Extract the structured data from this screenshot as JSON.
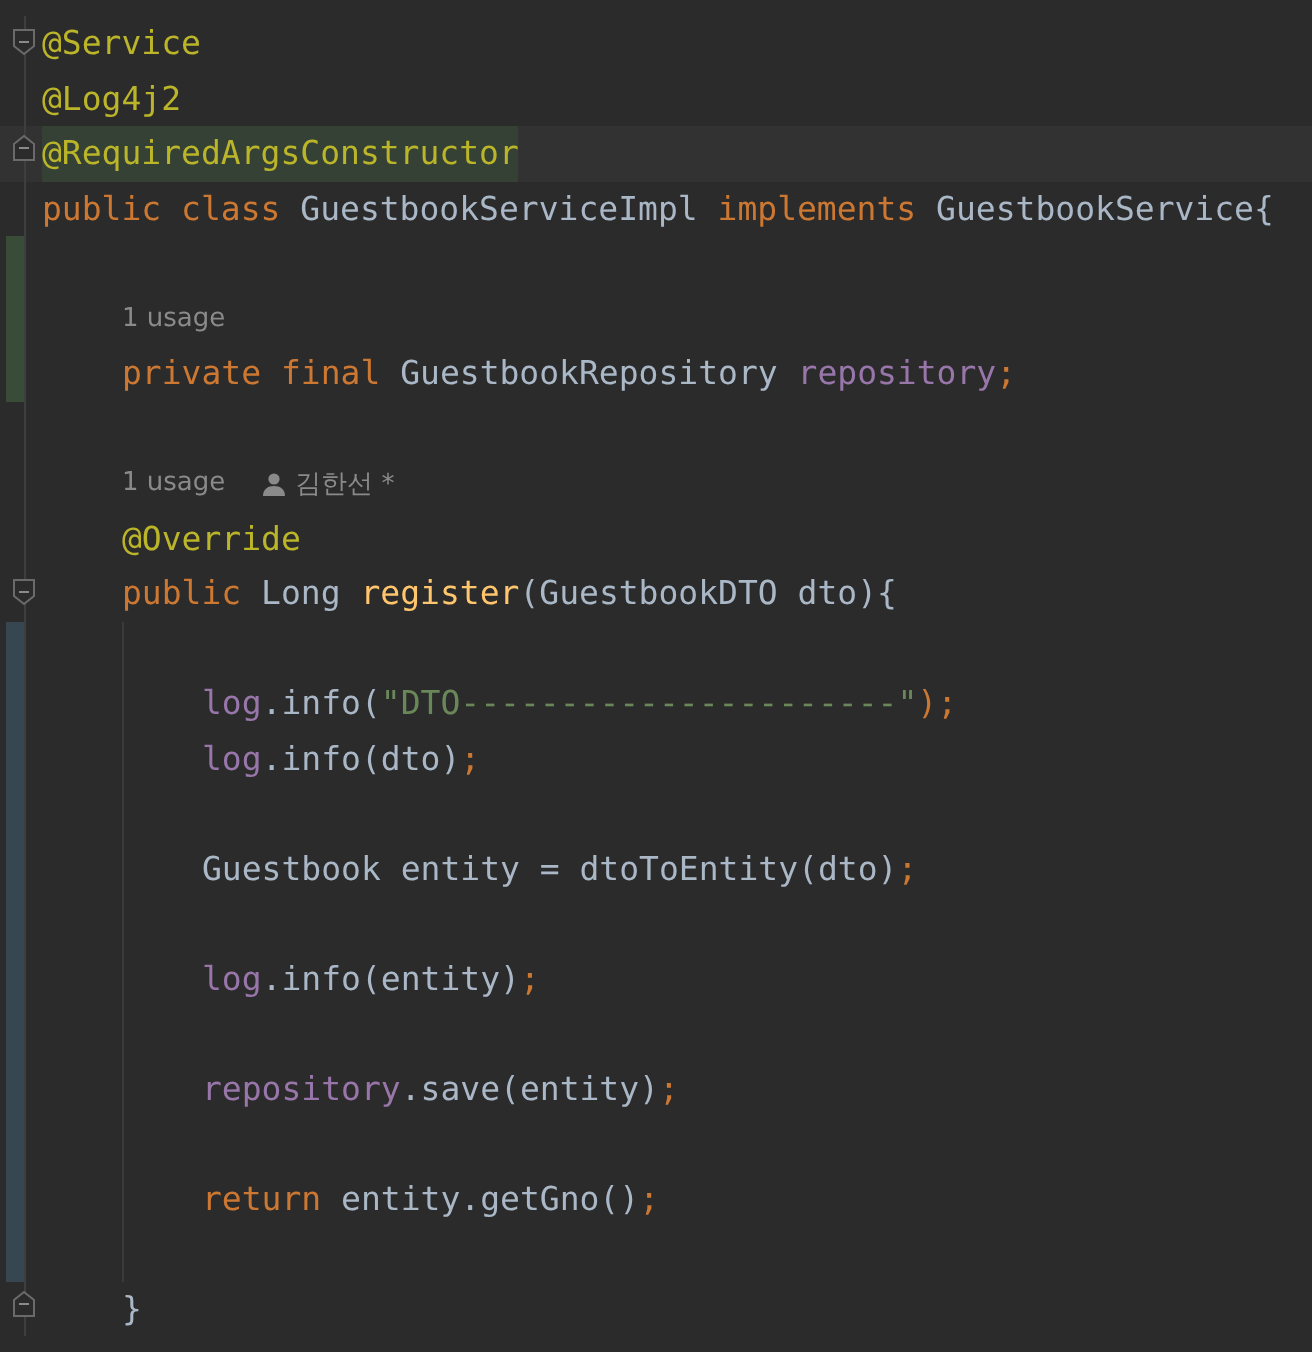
{
  "lines": [
    {
      "kind": "code",
      "gutter": {
        "kind": "fold-start"
      },
      "tokens": [
        {
          "text": "@Service",
          "kind": "annotation"
        }
      ]
    },
    {
      "kind": "code",
      "tokens": [
        {
          "text": "@Log4j2",
          "kind": "annotation"
        }
      ]
    },
    {
      "kind": "code",
      "gutter": {
        "kind": "fold-end"
      },
      "highlighted": true,
      "tokens": [
        {
          "text": "@RequiredArgsConstructor",
          "kind": "annotation"
        }
      ]
    },
    {
      "kind": "code",
      "tokens": [
        {
          "text": "public class ",
          "kind": "keyword"
        },
        {
          "text": "GuestbookServiceImpl ",
          "kind": "type"
        },
        {
          "text": "implements ",
          "kind": "keyword"
        },
        {
          "text": "GuestbookService{",
          "kind": "type"
        }
      ],
      "children": [
        {
          "kind": "blank",
          "change": {
            "color": "#384c38"
          }
        },
        {
          "kind": "hint",
          "change": {
            "color": "#384c38"
          },
          "usage": "1 usage"
        },
        {
          "kind": "code",
          "change": {
            "color": "#384c38"
          },
          "tokens": [
            {
              "text": "private final ",
              "kind": "keyword"
            },
            {
              "text": "GuestbookRepository ",
              "kind": "type"
            },
            {
              "text": "repository",
              "kind": "field"
            },
            {
              "text": ";",
              "kind": "keyword"
            }
          ]
        },
        {
          "kind": "blank"
        },
        {
          "kind": "hint",
          "usage": "1 usage",
          "author": "김한선 *"
        },
        {
          "kind": "code",
          "tokens": [
            {
              "text": "@Override",
              "kind": "annotation"
            }
          ]
        },
        {
          "kind": "code",
          "gutter": {
            "kind": "fold-start"
          },
          "tokens": [
            {
              "text": "public ",
              "kind": "keyword"
            },
            {
              "text": "Long ",
              "kind": "type"
            },
            {
              "text": "register",
              "kind": "method"
            },
            {
              "text": "(GuestbookDTO dto){",
              "kind": "type"
            }
          ],
          "children": [
            {
              "kind": "blank",
              "change": {
                "color": "#374752"
              }
            },
            {
              "kind": "code",
              "change": {
                "color": "#374752"
              },
              "tokens": [
                {
                  "text": "log",
                  "kind": "field"
                },
                {
                  "text": ".info(",
                  "kind": "type"
                },
                {
                  "text": "\"DTO----------------------\"",
                  "kind": "string"
                },
                {
                  "text": ");",
                  "kind": "keyword"
                }
              ]
            },
            {
              "kind": "code",
              "change": {
                "color": "#374752"
              },
              "tokens": [
                {
                  "text": "log",
                  "kind": "field"
                },
                {
                  "text": ".info(dto)",
                  "kind": "type"
                },
                {
                  "text": ";",
                  "kind": "keyword"
                }
              ]
            },
            {
              "kind": "blank",
              "change": {
                "color": "#374752"
              }
            },
            {
              "kind": "code",
              "change": {
                "color": "#374752"
              },
              "tokens": [
                {
                  "text": "Guestbook entity = dtoToEntity(dto)",
                  "kind": "type"
                },
                {
                  "text": ";",
                  "kind": "keyword"
                }
              ]
            },
            {
              "kind": "blank",
              "change": {
                "color": "#374752"
              }
            },
            {
              "kind": "code",
              "change": {
                "color": "#374752"
              },
              "tokens": [
                {
                  "text": "log",
                  "kind": "field"
                },
                {
                  "text": ".info(entity)",
                  "kind": "type"
                },
                {
                  "text": ";",
                  "kind": "keyword"
                }
              ]
            },
            {
              "kind": "blank",
              "change": {
                "color": "#374752"
              }
            },
            {
              "kind": "code",
              "change": {
                "color": "#374752"
              },
              "tokens": [
                {
                  "text": "repository",
                  "kind": "field"
                },
                {
                  "text": ".save(entity)",
                  "kind": "type"
                },
                {
                  "text": ";",
                  "kind": "keyword"
                }
              ]
            },
            {
              "kind": "blank",
              "change": {
                "color": "#374752"
              }
            },
            {
              "kind": "code",
              "change": {
                "color": "#374752"
              },
              "tokens": [
                {
                  "text": "return ",
                  "kind": "keyword"
                },
                {
                  "text": "entity.getGno()",
                  "kind": "type"
                },
                {
                  "text": ";",
                  "kind": "keyword"
                }
              ]
            },
            {
              "kind": "blank",
              "change": {
                "color": "#374752"
              }
            }
          ]
        },
        {
          "kind": "code",
          "gutter": {
            "kind": "fold-end"
          },
          "tokens": [
            {
              "text": "}",
              "kind": "type"
            }
          ]
        }
      ]
    }
  ]
}
